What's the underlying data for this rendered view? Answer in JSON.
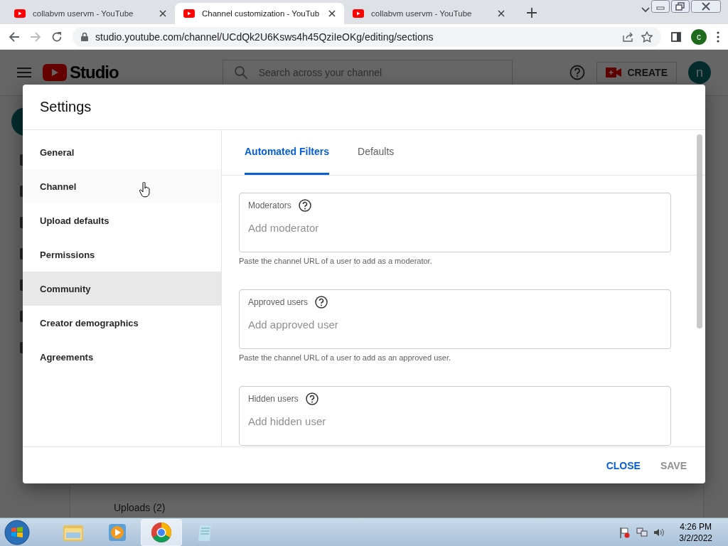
{
  "browser": {
    "tabs": [
      {
        "title": "collabvm uservm - YouTube",
        "selected": false
      },
      {
        "title": "Channel customization - YouTub",
        "selected": true
      },
      {
        "title": "collabvm uservm - YouTube",
        "selected": false
      }
    ],
    "url": "studio.youtube.com/channel/UCdQk2U6Ksws4h45QziIeOKg/editing/sections",
    "profile": "c"
  },
  "studio": {
    "logo": "Studio",
    "search_placeholder": "Search across your channel",
    "create": "CREATE",
    "avatar": "n",
    "uploads": "Uploads (2)"
  },
  "dialog": {
    "title": "Settings",
    "nav": [
      {
        "label": "General",
        "selected": false,
        "hovered": false
      },
      {
        "label": "Channel",
        "selected": false,
        "hovered": true
      },
      {
        "label": "Upload defaults",
        "selected": false,
        "hovered": false
      },
      {
        "label": "Permissions",
        "selected": false,
        "hovered": false
      },
      {
        "label": "Community",
        "selected": true,
        "hovered": false
      },
      {
        "label": "Creator demographics",
        "selected": false,
        "hovered": false
      },
      {
        "label": "Agreements",
        "selected": false,
        "hovered": false
      }
    ],
    "tabs": [
      {
        "label": "Automated Filters",
        "selected": true
      },
      {
        "label": "Defaults",
        "selected": false
      }
    ],
    "fields": [
      {
        "label": "Moderators",
        "placeholder": "Add moderator",
        "helper": "Paste the channel URL of a user to add as a moderator."
      },
      {
        "label": "Approved users",
        "placeholder": "Add approved user",
        "helper": "Paste the channel URL of a user to add as an approved user."
      },
      {
        "label": "Hidden users",
        "placeholder": "Add hidden user"
      }
    ],
    "buttons": [
      {
        "label": "CLOSE",
        "disabled": false
      },
      {
        "label": "SAVE",
        "disabled": true
      }
    ]
  },
  "taskbar": {
    "apps": [
      {
        "kind": "folder",
        "selected": false
      },
      {
        "kind": "media",
        "selected": false
      },
      {
        "kind": "chrome",
        "selected": true
      },
      {
        "kind": "notepad",
        "selected": false
      }
    ],
    "time": "4:26 PM",
    "date": "3/2/2022"
  }
}
